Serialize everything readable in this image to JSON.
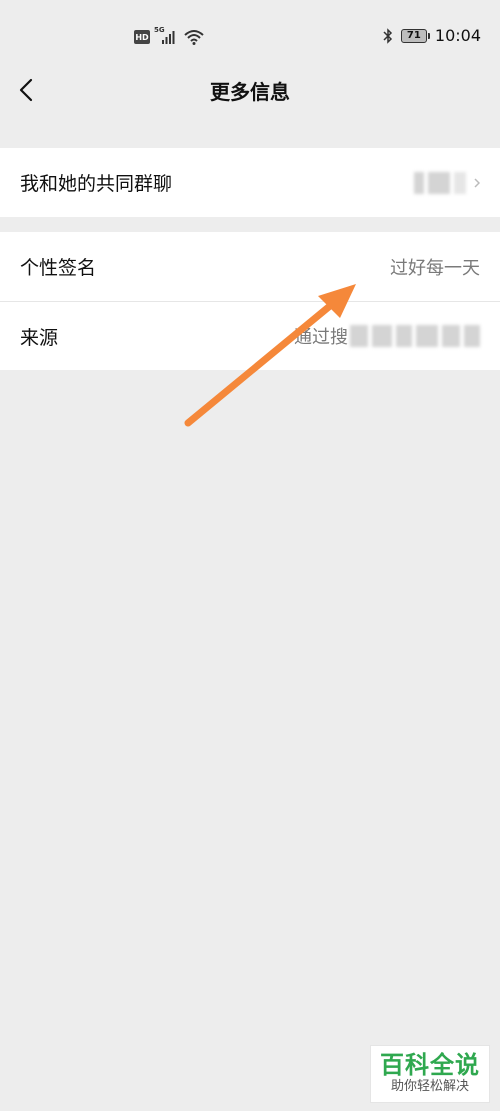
{
  "status_bar": {
    "hd": "HD",
    "network": "5G",
    "battery": "71",
    "time": "10:04"
  },
  "nav": {
    "title": "更多信息"
  },
  "group1": {
    "items": [
      {
        "label": "我和她的共同群聊",
        "value": ""
      }
    ]
  },
  "group2": {
    "items": [
      {
        "label": "个性签名",
        "value": "过好每一天"
      },
      {
        "label": "来源",
        "value": "通过搜"
      }
    ]
  },
  "annotation": {
    "color": "#f5883a"
  },
  "watermark": {
    "title": "百科全说",
    "subtitle": "助你轻松解决"
  }
}
